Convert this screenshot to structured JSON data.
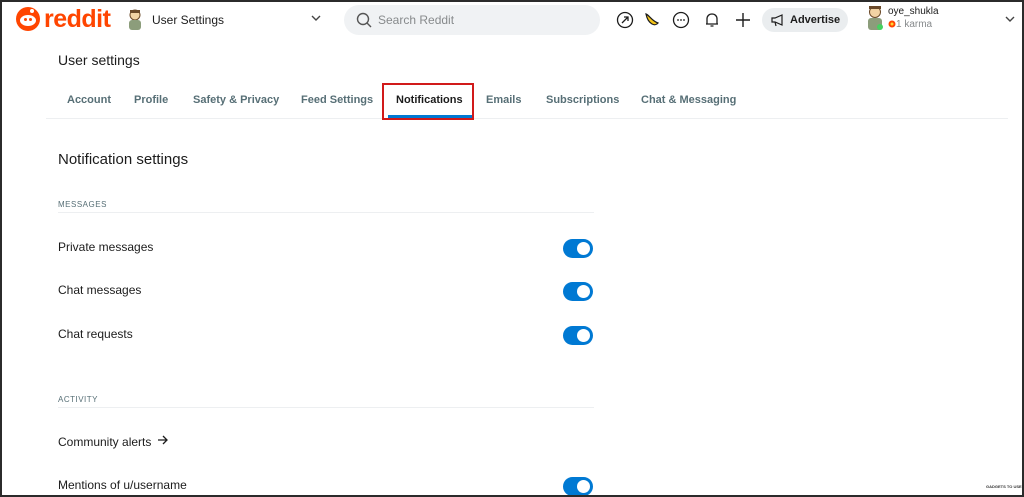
{
  "header": {
    "logo_text": "reddit",
    "community_label": "User Settings",
    "search_placeholder": "Search Reddit",
    "advertise_label": "Advertise",
    "username": "oye_shukla",
    "karma": "1 karma"
  },
  "page": {
    "title": "User settings",
    "tabs": [
      {
        "label": "Account"
      },
      {
        "label": "Profile"
      },
      {
        "label": "Safety & Privacy"
      },
      {
        "label": "Feed Settings"
      },
      {
        "label": "Notifications"
      },
      {
        "label": "Emails"
      },
      {
        "label": "Subscriptions"
      },
      {
        "label": "Chat & Messaging"
      }
    ],
    "active_tab": "Notifications"
  },
  "notifications": {
    "section_title": "Notification settings",
    "messages_group": "MESSAGES",
    "activity_group": "ACTIVITY",
    "messages": [
      {
        "label": "Private messages",
        "enabled": true
      },
      {
        "label": "Chat messages",
        "enabled": true
      },
      {
        "label": "Chat requests",
        "enabled": true
      }
    ],
    "community_alerts": "Community alerts",
    "mentions": {
      "label": "Mentions of u/username",
      "enabled": true
    }
  },
  "colors": {
    "brand": "#ff4500",
    "toggle_on": "#0079d3",
    "highlight": "#d11a1a"
  },
  "watermark": "GADGETS TO USE"
}
